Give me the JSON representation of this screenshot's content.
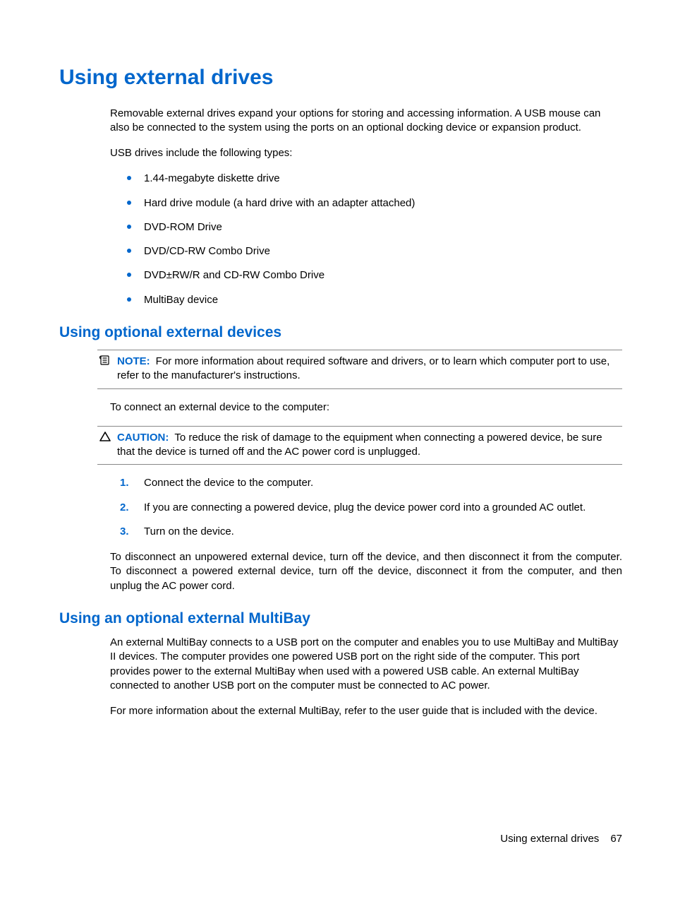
{
  "heading": "Using external drives",
  "intro": "Removable external drives expand your options for storing and accessing information. A USB mouse can also be connected to the system using the ports on an optional docking device or expansion product.",
  "usb_lead": "USB drives include the following types:",
  "usb_types": [
    "1.44-megabyte diskette drive",
    "Hard drive module (a hard drive with an adapter attached)",
    "DVD-ROM Drive",
    "DVD/CD-RW Combo Drive",
    "DVD±RW/R and CD-RW Combo Drive",
    "MultiBay device"
  ],
  "section_optional_devices": {
    "title": "Using optional external devices",
    "note_label": "NOTE:",
    "note_text": "For more information about required software and drivers, or to learn which computer port to use, refer to the manufacturer's instructions.",
    "connect_lead": "To connect an external device to the computer:",
    "caution_label": "CAUTION:",
    "caution_text": "To reduce the risk of damage to the equipment when connecting a powered device, be sure that the device is turned off and the AC power cord is unplugged.",
    "steps": [
      "Connect the device to the computer.",
      "If you are connecting a powered device, plug the device power cord into a grounded AC outlet.",
      "Turn on the device."
    ],
    "disconnect_text": "To disconnect an unpowered external device, turn off the device, and then disconnect it from the computer. To disconnect a powered external device, turn off the device, disconnect it from the computer, and then unplug the AC power cord."
  },
  "section_multibay": {
    "title": "Using an optional external MultiBay",
    "para1": "An external MultiBay connects to a USB port on the computer and enables you to use MultiBay and MultiBay II devices. The computer provides one powered USB port on the right side of the computer. This port provides power to the external MultiBay when used with a powered USB cable. An external MultiBay connected to another USB port on the computer must be connected to AC power.",
    "para2": "For more information about the external MultiBay, refer to the user guide that is included with the device."
  },
  "footer": {
    "title": "Using external drives",
    "page": "67"
  }
}
